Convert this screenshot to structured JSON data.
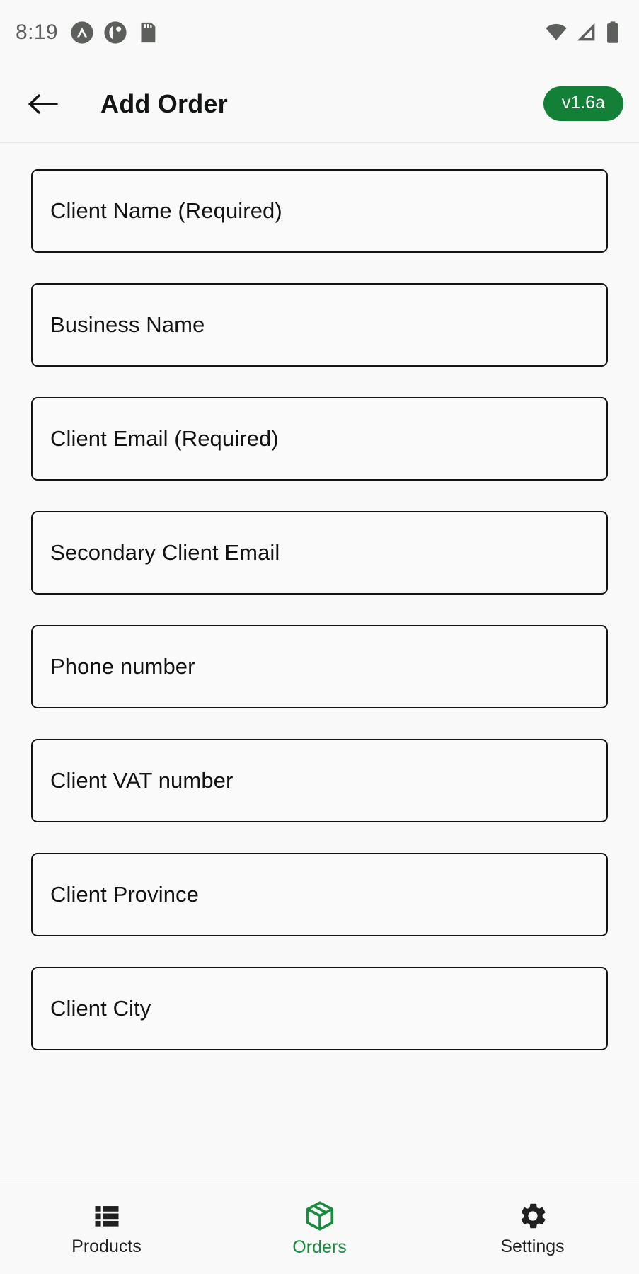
{
  "status_bar": {
    "time": "8:19",
    "left_icons": [
      "nord-vpn-icon",
      "app-notification-icon",
      "sd-card-icon"
    ],
    "right_icons": [
      "wifi-icon",
      "cellular-signal-icon",
      "battery-icon"
    ]
  },
  "app_bar": {
    "back_icon": "back-arrow-icon",
    "title": "Add Order",
    "version_badge": "v1.6a",
    "badge_color": "#128037"
  },
  "form": {
    "fields": [
      {
        "label": "Client Name (Required)",
        "name": "client-name"
      },
      {
        "label": "Business Name",
        "name": "business-name"
      },
      {
        "label": "Client Email (Required)",
        "name": "client-email"
      },
      {
        "label": "Secondary Client Email",
        "name": "secondary-client-email"
      },
      {
        "label": "Phone number",
        "name": "phone-number"
      },
      {
        "label": "Client VAT number",
        "name": "client-vat-number"
      },
      {
        "label": "Client Province",
        "name": "client-province"
      },
      {
        "label": "Client City",
        "name": "client-city"
      }
    ]
  },
  "bottom_nav": {
    "active_color": "#1a8c3f",
    "inactive_color": "#1f201f",
    "items": [
      {
        "label": "Products",
        "icon": "list-view-icon",
        "active": false
      },
      {
        "label": "Orders",
        "icon": "package-box-icon",
        "active": true
      },
      {
        "label": "Settings",
        "icon": "gear-icon",
        "active": false
      }
    ]
  }
}
